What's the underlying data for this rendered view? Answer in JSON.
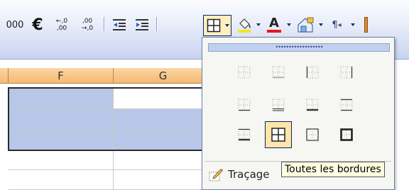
{
  "toolbar": {
    "thousands_label": "000",
    "currency_label": "€",
    "increase_decimal_top": "←,0",
    "increase_decimal_bottom": ",00",
    "decrease_decimal_top": ",00",
    "decrease_decimal_bottom": "→,0",
    "font_color_letter": "A",
    "paragraph_label": "¶"
  },
  "grid": {
    "columns": [
      "F",
      "G"
    ]
  },
  "border_menu": {
    "drag_handle_dots": "••••••••••••••••••",
    "rows": [
      [
        "no-border-icon",
        "bottom-border-icon-grey",
        "left-border-icon",
        "right-border-icon"
      ],
      [
        "bottom-border-icon",
        "double-bottom-border-icon",
        "thick-bottom-border-icon",
        "top-bottom-border-icon"
      ],
      [
        "top-thick-bottom-border-icon",
        "all-borders-icon",
        "outside-borders-icon",
        "thick-box-border-icon"
      ]
    ],
    "draw_borders_label": "Traçage",
    "draw_borders_underline": "T"
  },
  "tooltip": {
    "text": "Toutes les bordures"
  },
  "colors": {
    "accent_selection": "#b8c7e8",
    "header_orange": "#f5b971",
    "highlight": "#ffe6a8"
  }
}
